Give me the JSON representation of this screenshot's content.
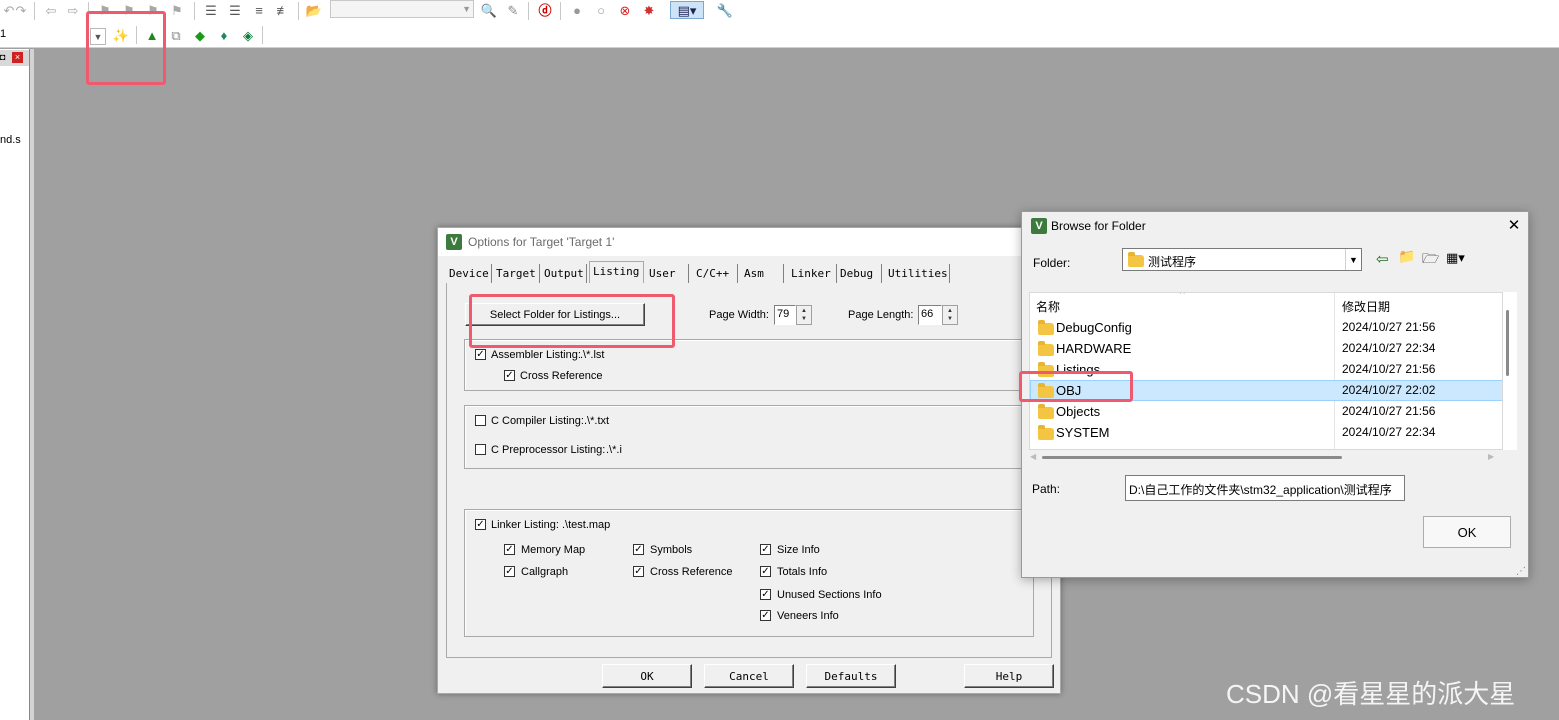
{
  "ide": {
    "target_combo_value": "1",
    "left_panel_file_fragment": "nd.s"
  },
  "options_dialog": {
    "title": "Options for Target 'Target 1'",
    "tabs": [
      "Device",
      "Target",
      "Output",
      "Listing",
      "User",
      "C/C++",
      "Asm",
      "Linker",
      "Debug",
      "Utilities"
    ],
    "active_tab": "Listing",
    "select_folder_label": "Select Folder for Listings...",
    "page_width_label": "Page Width:",
    "page_width_value": "79",
    "page_length_label": "Page Length:",
    "page_length_value": "66",
    "assembler_listing": {
      "label": "Assembler Listing:",
      "value": ".\\*.lst",
      "checked": true
    },
    "asm_cross_reference": {
      "label": "Cross Reference",
      "checked": true
    },
    "c_compiler_listing": {
      "label": "C Compiler Listing:",
      "value": ".\\*.txt",
      "checked": false
    },
    "c_preprocessor_listing": {
      "label": "C Preprocessor Listing:",
      "value": ".\\*.i",
      "checked": false
    },
    "linker_listing": {
      "label": "Linker Listing:",
      "value": ".\\test.map",
      "checked": true
    },
    "linker_options": {
      "memory_map": "Memory Map",
      "callgraph": "Callgraph",
      "symbols": "Symbols",
      "cross_reference": "Cross Reference",
      "size_info": "Size Info",
      "totals_info": "Totals Info",
      "unused_sections_info": "Unused Sections Info",
      "veneers_info": "Veneers Info"
    },
    "buttons": {
      "ok": "OK",
      "cancel": "Cancel",
      "defaults": "Defaults",
      "help": "Help"
    }
  },
  "browse_dialog": {
    "title": "Browse for Folder",
    "folder_label": "Folder:",
    "folder_value": "测试程序",
    "columns": {
      "name": "名称",
      "modified": "修改日期"
    },
    "rows": [
      {
        "name": "DebugConfig",
        "date": "2024/10/27 21:56"
      },
      {
        "name": "HARDWARE",
        "date": "2024/10/27 22:34"
      },
      {
        "name": "Listings",
        "date": "2024/10/27 21:56"
      },
      {
        "name": "OBJ",
        "date": "2024/10/27 22:02"
      },
      {
        "name": "Objects",
        "date": "2024/10/27 21:56"
      },
      {
        "name": "SYSTEM",
        "date": "2024/10/27 22:34"
      }
    ],
    "selected_row": "OBJ",
    "path_label": "Path:",
    "path_value": "D:\\自己工作的文件夹\\stm32_application\\测试程序",
    "ok_label": "OK"
  },
  "watermark": "CSDN @看星星的派大星",
  "highlight_color": "#f05a6e",
  "icons": [
    "undo-icon",
    "redo-icon",
    "back-icon",
    "forward-icon",
    "bookmark-icon",
    "indent-icon",
    "outdent-icon",
    "comment-icon",
    "open-file-icon",
    "find-in-files-icon",
    "debug-icon",
    "breakpoint-icon",
    "magic-wand-icon",
    "target-options-icon",
    "manage-components-icon",
    "pack-installer-icon",
    "settings-icon",
    "close-icon"
  ]
}
